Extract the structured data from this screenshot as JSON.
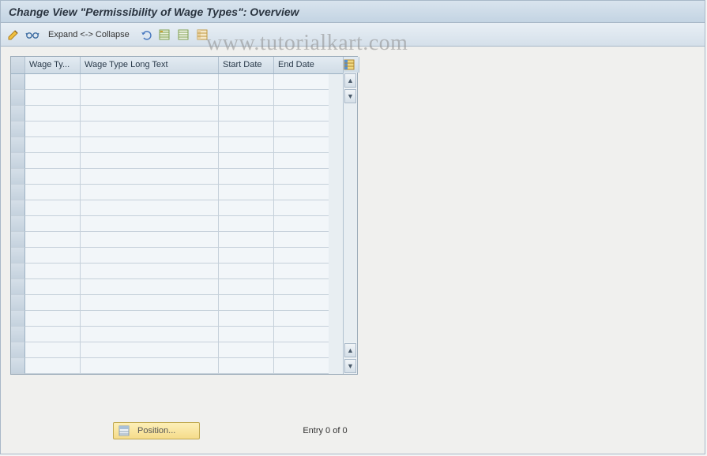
{
  "title": "Change View \"Permissibility of Wage Types\": Overview",
  "toolbar": {
    "expand_collapse_label": "Expand <-> Collapse"
  },
  "table": {
    "columns": {
      "wage_type": "Wage Ty...",
      "wage_type_long": "Wage Type Long Text",
      "start_date": "Start Date",
      "end_date": "End Date"
    },
    "rows": [
      {
        "wage_type": "",
        "long_text": "",
        "start": "",
        "end": ""
      },
      {
        "wage_type": "",
        "long_text": "",
        "start": "",
        "end": ""
      },
      {
        "wage_type": "",
        "long_text": "",
        "start": "",
        "end": ""
      },
      {
        "wage_type": "",
        "long_text": "",
        "start": "",
        "end": ""
      },
      {
        "wage_type": "",
        "long_text": "",
        "start": "",
        "end": ""
      },
      {
        "wage_type": "",
        "long_text": "",
        "start": "",
        "end": ""
      },
      {
        "wage_type": "",
        "long_text": "",
        "start": "",
        "end": ""
      },
      {
        "wage_type": "",
        "long_text": "",
        "start": "",
        "end": ""
      },
      {
        "wage_type": "",
        "long_text": "",
        "start": "",
        "end": ""
      },
      {
        "wage_type": "",
        "long_text": "",
        "start": "",
        "end": ""
      },
      {
        "wage_type": "",
        "long_text": "",
        "start": "",
        "end": ""
      },
      {
        "wage_type": "",
        "long_text": "",
        "start": "",
        "end": ""
      },
      {
        "wage_type": "",
        "long_text": "",
        "start": "",
        "end": ""
      },
      {
        "wage_type": "",
        "long_text": "",
        "start": "",
        "end": ""
      },
      {
        "wage_type": "",
        "long_text": "",
        "start": "",
        "end": ""
      },
      {
        "wage_type": "",
        "long_text": "",
        "start": "",
        "end": ""
      },
      {
        "wage_type": "",
        "long_text": "",
        "start": "",
        "end": ""
      },
      {
        "wage_type": "",
        "long_text": "",
        "start": "",
        "end": ""
      },
      {
        "wage_type": "",
        "long_text": "",
        "start": "",
        "end": ""
      }
    ]
  },
  "footer": {
    "position_label": "Position...",
    "entry_text": "Entry 0 of 0"
  },
  "watermark": "www.tutorialkart.com"
}
